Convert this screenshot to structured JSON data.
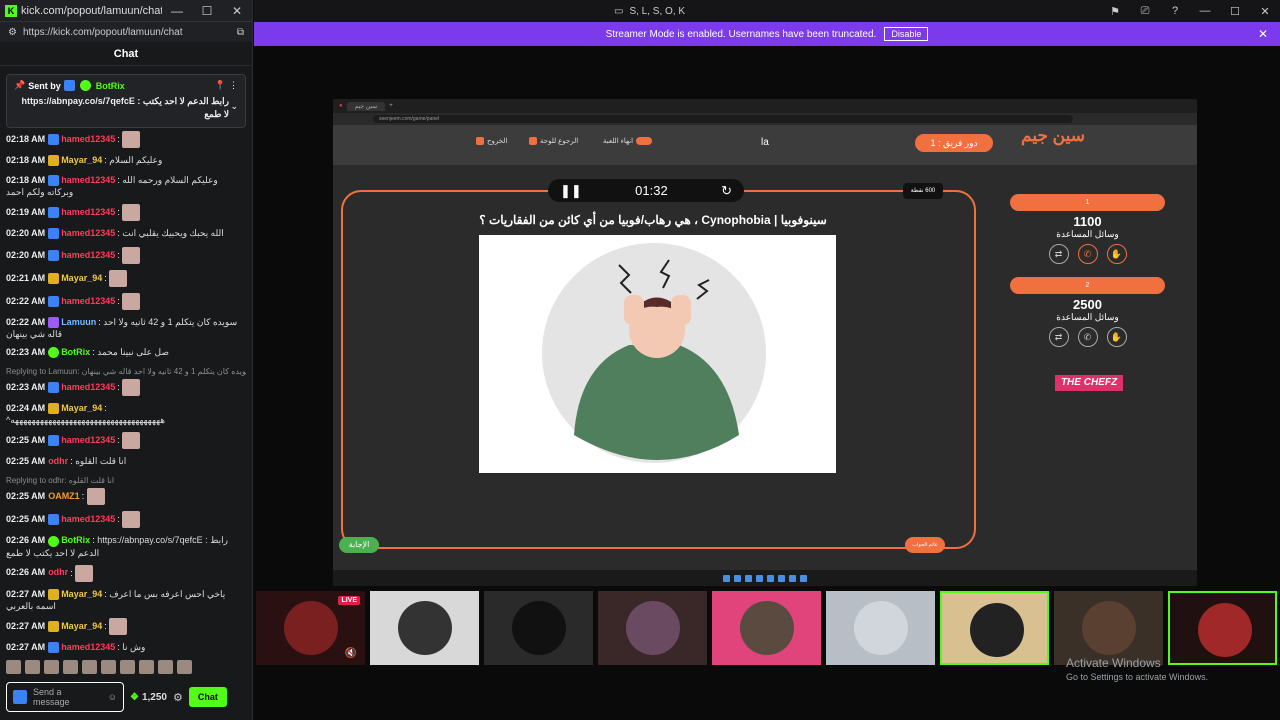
{
  "chat_window": {
    "title": "kick.com/popout/lamuun/chat - ...",
    "url": "https://kick.com/popout/lamuun/chat",
    "header": "Chat",
    "pinned": {
      "sent_by": "Sent by",
      "sender": "BotRix",
      "text": "رابط الدعم لا احد يكتب : https://abnpay.co/s/7qefcE لا طمع"
    },
    "messages": [
      {
        "time": "02:18 AM",
        "user": "hamed12345",
        "color": "#ff3c5a",
        "text": "",
        "badge": "b-blue"
      },
      {
        "time": "02:18 AM",
        "user": "Mayar_94",
        "color": "#f0c84a",
        "text": "وعليكم السلام",
        "badge": "b-gold"
      },
      {
        "time": "02:18 AM",
        "user": "hamed12345",
        "color": "#ff3c5a",
        "text": "وعليكم السلام ورحمه الله وبركاته ولكم احمد",
        "badge": "b-blue"
      },
      {
        "time": "02:19 AM",
        "user": "hamed12345",
        "color": "#ff3c5a",
        "text": "",
        "badge": "b-blue"
      },
      {
        "time": "02:20 AM",
        "user": "hamed12345",
        "color": "#ff3c5a",
        "text": "الله يحبك ويحبيك يقلبي انت",
        "badge": "b-blue"
      },
      {
        "time": "02:20 AM",
        "user": "hamed12345",
        "color": "#ff3c5a",
        "text": "",
        "badge": "b-blue"
      },
      {
        "time": "02:21 AM",
        "user": "Mayar_94",
        "color": "#f0c84a",
        "text": "",
        "badge": "b-gold"
      },
      {
        "time": "02:22 AM",
        "user": "hamed12345",
        "color": "#ff3c5a",
        "text": "",
        "badge": "b-blue"
      },
      {
        "time": "02:22 AM",
        "user": "Lamuun",
        "color": "#7ab8ff",
        "text": "سويده كان يتكلم 1 و 42 ثانيه ولا احد قاله شي بينهان",
        "badge": "b-vip"
      },
      {
        "time": "02:23 AM",
        "user": "BotRix",
        "color": "#53fc18",
        "text": "صل على نبينا محمد",
        "badge": "b-green"
      },
      {
        "time": "02:23 AM",
        "user": "hamed12345",
        "color": "#ff3c5a",
        "text": "",
        "badge": "b-blue",
        "reply": "Replying to Lamuun: سويده كان يتكلم 1 و 42 ثانيه ولا احد قاله شي بينهان"
      },
      {
        "time": "02:24 AM",
        "user": "Mayar_94",
        "color": "#f0c84a",
        "text": "^ههههههههههههههههههههههههههههههههههههه",
        "badge": "b-gold"
      },
      {
        "time": "02:25 AM",
        "user": "hamed12345",
        "color": "#ff3c5a",
        "text": "",
        "badge": "b-blue"
      },
      {
        "time": "02:25 AM",
        "user": "odhr",
        "color": "#ff3c5a",
        "text": "انا قلت القلوه",
        "badge": ""
      },
      {
        "time": "02:25 AM",
        "user": "OAMZ1",
        "color": "#f0a030",
        "text": "",
        "badge": "",
        "reply": "Replying to odhr: انا قلت القلوه"
      },
      {
        "time": "02:25 AM",
        "user": "hamed12345",
        "color": "#ff3c5a",
        "text": "",
        "badge": "b-blue"
      },
      {
        "time": "02:26 AM",
        "user": "BotRix",
        "color": "#53fc18",
        "text": "https://abnpay.co/s/7qefcE : رابط الدعم لا احد يكتب لا طمع",
        "badge": "b-green"
      },
      {
        "time": "02:26 AM",
        "user": "odhr",
        "color": "#ff3c5a",
        "text": "",
        "badge": ""
      },
      {
        "time": "02:27 AM",
        "user": "Mayar_94",
        "color": "#f0c84a",
        "text": "ياخي احس اعرفه بس ما اعرف اسمه بالعربي",
        "badge": "b-gold"
      },
      {
        "time": "02:27 AM",
        "user": "Mayar_94",
        "color": "#f0c84a",
        "text": "",
        "badge": "b-gold"
      },
      {
        "time": "02:27 AM",
        "user": "hamed12345",
        "color": "#ff3c5a",
        "text": "وش نا",
        "badge": "b-blue"
      }
    ],
    "input_placeholder": "Send a message",
    "points": "1,250",
    "chat_button": "Chat"
  },
  "main_window": {
    "title": "S, L, S, O, K",
    "streamer_banner": "Streamer Mode is enabled. Usernames have been truncated.",
    "disable_button": "Disable",
    "game": {
      "tab": "سين جيم",
      "address": "seenjeem.com/game/panel",
      "turn": "دور فريق : 1",
      "la": "la",
      "controls": [
        "انهاء اللعبة",
        "الرجوع للوحة",
        "الخروج"
      ],
      "logo": "سين جيم",
      "timer": "01:32",
      "points_badge": "600 نقطة",
      "question": "سينوفوبيا | Cynophobia ، هي رهاب/فوبيا من أي كائن من الفقاريات ؟",
      "answer_button": "الإجابة",
      "other_button": "عاتم الجواب",
      "teams": [
        {
          "name": "1",
          "score": "1100",
          "helps_label": "وسائل المساعدة"
        },
        {
          "name": "2",
          "score": "2500",
          "helps_label": "وسائل المساعدة"
        }
      ],
      "sponsor": "THE CHEFZ"
    },
    "live_badge": "LIVE",
    "activate": {
      "line1": "Activate Windows",
      "line2": "Go to Settings to activate Windows."
    }
  },
  "colors": {
    "kick_green": "#53fc18",
    "banner_purple": "#7c3aed",
    "game_orange": "#f07040"
  }
}
